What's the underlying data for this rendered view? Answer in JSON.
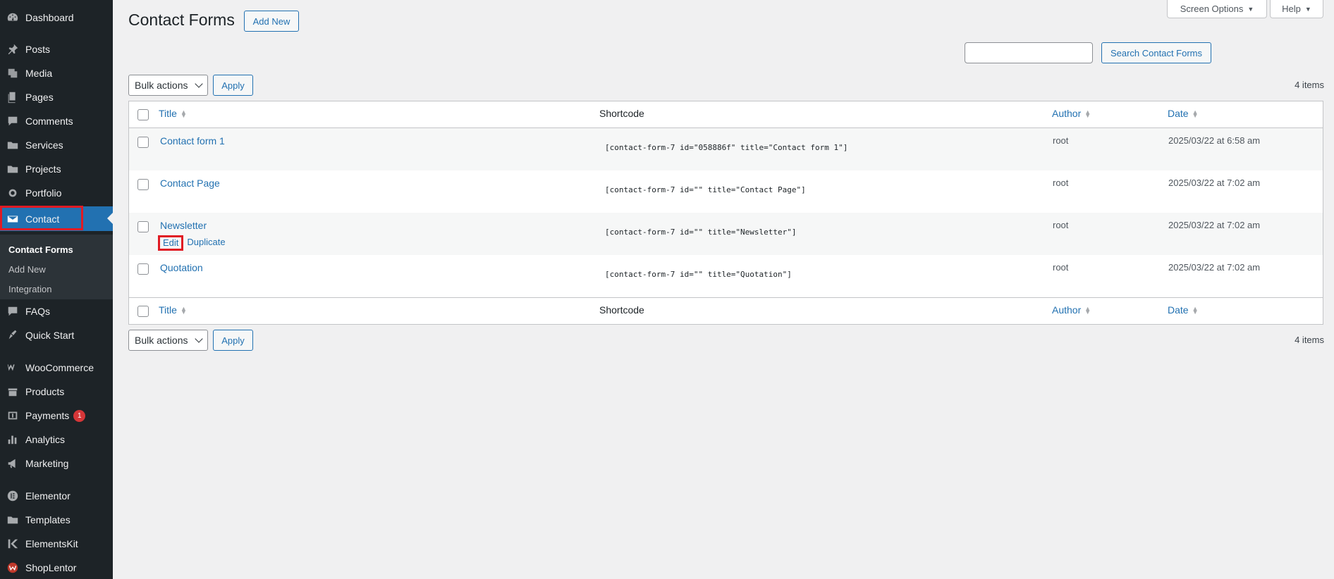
{
  "sidebar": {
    "items": [
      {
        "label": "Dashboard",
        "icon": "dashboard-icon"
      },
      {
        "label": "Posts",
        "icon": "pin-icon"
      },
      {
        "label": "Media",
        "icon": "media-icon"
      },
      {
        "label": "Pages",
        "icon": "pages-icon"
      },
      {
        "label": "Comments",
        "icon": "comments-icon"
      },
      {
        "label": "Services",
        "icon": "folder-icon"
      },
      {
        "label": "Projects",
        "icon": "folder-icon"
      },
      {
        "label": "Portfolio",
        "icon": "portfolio-icon"
      },
      {
        "label": "Contact",
        "icon": "mail-icon"
      },
      {
        "label": "FAQs",
        "icon": "comments-icon"
      },
      {
        "label": "Quick Start",
        "icon": "quickstart-icon"
      },
      {
        "label": "WooCommerce",
        "icon": "woocommerce-icon"
      },
      {
        "label": "Products",
        "icon": "products-icon"
      },
      {
        "label": "Payments",
        "icon": "payments-icon",
        "badge": "1"
      },
      {
        "label": "Analytics",
        "icon": "analytics-icon"
      },
      {
        "label": "Marketing",
        "icon": "marketing-icon"
      },
      {
        "label": "Elementor",
        "icon": "elementor-icon"
      },
      {
        "label": "Templates",
        "icon": "templates-icon"
      },
      {
        "label": "ElementsKit",
        "icon": "elementskit-icon"
      },
      {
        "label": "ShopLentor",
        "icon": "shoplentor-icon"
      }
    ],
    "submenu": [
      "Contact Forms",
      "Add New",
      "Integration"
    ]
  },
  "header": {
    "title": "Contact Forms",
    "add_new": "Add New",
    "screen_options": "Screen Options",
    "help": "Help",
    "search_button": "Search Contact Forms",
    "search_value": ""
  },
  "bulk": {
    "label": "Bulk actions",
    "apply": "Apply",
    "count": "4 items"
  },
  "table": {
    "columns": {
      "title": "Title",
      "shortcode": "Shortcode",
      "author": "Author",
      "date": "Date"
    },
    "rows": [
      {
        "title": "Contact form 1",
        "shortcode": "[contact-form-7 id=\"058886f\" title=\"Contact form 1\"]",
        "author": "root",
        "date": "2025/03/22 at 6:58 am"
      },
      {
        "title": "Contact Page",
        "shortcode": "[contact-form-7 id=\"\" title=\"Contact Page\"]",
        "author": "root",
        "date": "2025/03/22 at 7:02 am"
      },
      {
        "title": "Newsletter",
        "shortcode": "[contact-form-7 id=\"\" title=\"Newsletter\"]",
        "author": "root",
        "date": "2025/03/22 at 7:02 am",
        "actions": [
          "Edit",
          "Duplicate"
        ]
      },
      {
        "title": "Quotation",
        "shortcode": "[contact-form-7 id=\"\" title=\"Quotation\"]",
        "author": "root",
        "date": "2025/03/22 at 7:02 am"
      }
    ]
  },
  "colors": {
    "sidebar_bg": "#1d2327",
    "accent": "#2271b1",
    "highlight": "#e01b24",
    "badge": "#d63638"
  }
}
